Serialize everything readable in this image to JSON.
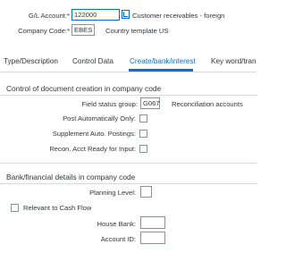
{
  "header": {
    "gl_account_label": "G/L Account:",
    "gl_account_value": "122000",
    "gl_account_desc": "Customer receivables - foreign",
    "company_code_label": "Company Code:",
    "company_code_value": "EBES",
    "company_code_desc": "Country template US",
    "required_mark": "*"
  },
  "tabs": [
    {
      "label": "Type/Description"
    },
    {
      "label": "Control Data"
    },
    {
      "label": "Create/bank/interest"
    },
    {
      "label": "Key word/tran"
    }
  ],
  "section_control": {
    "title": "Control of document creation in company code",
    "field_status_group_label": "Field status group:",
    "field_status_group_value": "G067",
    "field_status_group_desc": "Reconciliation accounts",
    "post_auto_label": "Post Automatically Only:",
    "post_auto_checked": false,
    "supplement_label": "Supplement Auto. Postings:",
    "supplement_checked": false,
    "recon_ready_label": "Recon. Acct Ready for Input:",
    "recon_ready_checked": false
  },
  "section_bank": {
    "title": "Bank/financial details in company code",
    "planning_level_label": "Planning Level:",
    "planning_level_value": "",
    "relevant_cash_flow_label": "Relevant to Cash Flow",
    "relevant_cash_flow_checked": false,
    "house_bank_label": "House Bank:",
    "house_bank_value": "",
    "account_id_label": "Account ID:",
    "account_id_value": ""
  },
  "colors": {
    "accent": "#0a6ed1",
    "text": "#32363a",
    "border": "#89919a"
  }
}
